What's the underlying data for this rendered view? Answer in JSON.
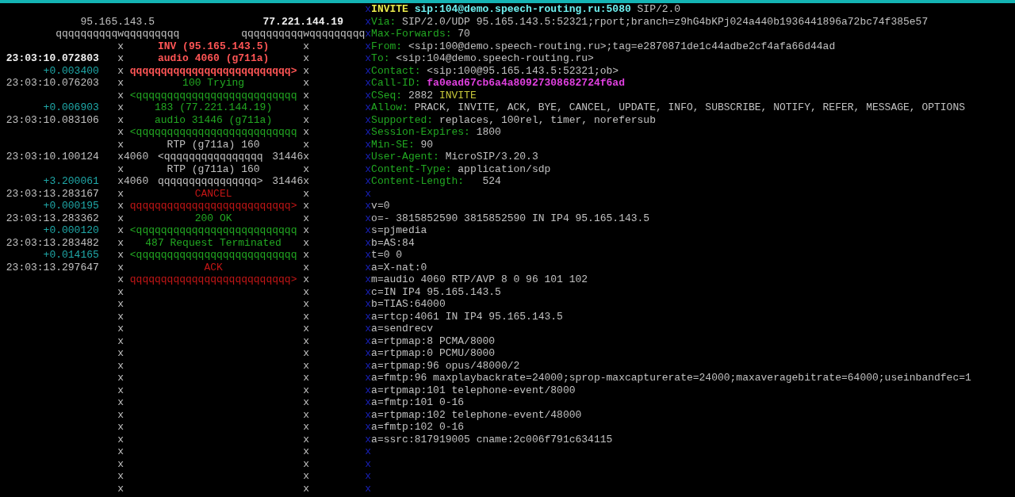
{
  "hosts": [
    {
      "address": "95.165.143.5",
      "rule": "qqqqqqqqqqwqqqqqqqqq",
      "selected": false
    },
    {
      "address": "77.221.144.19",
      "rule": "qqqqqqqqqqwqqqqqqqqq",
      "selected": true
    }
  ],
  "ladder": [
    {
      "left": "x",
      "label": "INV (95.165.143.5)",
      "right": "x",
      "kind": "invite"
    },
    {
      "time": {
        "text": "23:03:10.072803",
        "kind": "current"
      },
      "left": "x",
      "label": "audio 4060 (g711a)",
      "right": "x",
      "kind": "invite"
    },
    {
      "time": {
        "text": "+0.003400",
        "kind": "delta"
      },
      "left": "x",
      "arrow": "qqqqqqqqqqqqqqqqqqqqqqqqqq>",
      "right": "x",
      "kind": "invite"
    },
    {
      "time": {
        "text": "23:03:10.076203",
        "kind": "timestamp"
      },
      "left": "x",
      "label": "100 Trying",
      "right": "x",
      "kind": "response"
    },
    {
      "left": "x",
      "arrow": "<qqqqqqqqqqqqqqqqqqqqqqqqqq",
      "right": "x",
      "kind": "response"
    },
    {
      "time": {
        "text": "+0.006903",
        "kind": "delta"
      },
      "left": "x",
      "label": "183 (77.221.144.19)",
      "right": "x",
      "kind": "response"
    },
    {
      "time": {
        "text": "23:03:10.083106",
        "kind": "timestamp"
      },
      "left": "x",
      "label": "audio 31446 (g711a)",
      "right": "x",
      "kind": "response"
    },
    {
      "left": "x",
      "arrow": "<qqqqqqqqqqqqqqqqqqqqqqqqqq",
      "right": "x",
      "kind": "response"
    },
    {
      "left": "x",
      "label": "RTP (g711a) 160",
      "right": "x",
      "kind": "rtp"
    },
    {
      "time": {
        "text": "23:03:10.100124",
        "kind": "timestamp"
      },
      "left": "x4060",
      "arrow": "<qqqqqqqqqqqqqqqq",
      "right": "31446x",
      "kind": "rtp"
    },
    {
      "left": "x",
      "label": "RTP (g711a) 160",
      "right": "x",
      "kind": "rtp"
    },
    {
      "time": {
        "text": "+3.200061",
        "kind": "delta"
      },
      "left": "x4060",
      "arrow": "qqqqqqqqqqqqqqqq>",
      "right": "31446x",
      "kind": "rtp"
    },
    {
      "time": {
        "text": "23:03:13.283167",
        "kind": "timestamp"
      },
      "left": "x",
      "label": "CANCEL",
      "right": "x",
      "kind": "cancel"
    },
    {
      "time": {
        "text": "+0.000195",
        "kind": "delta"
      },
      "left": "x",
      "arrow": "qqqqqqqqqqqqqqqqqqqqqqqqqq>",
      "right": "x",
      "kind": "cancel"
    },
    {
      "time": {
        "text": "23:03:13.283362",
        "kind": "timestamp"
      },
      "left": "x",
      "label": "200 OK",
      "right": "x",
      "kind": "response"
    },
    {
      "time": {
        "text": "+0.000120",
        "kind": "delta"
      },
      "left": "x",
      "arrow": "<qqqqqqqqqqqqqqqqqqqqqqqqqq",
      "right": "x",
      "kind": "response"
    },
    {
      "time": {
        "text": "23:03:13.283482",
        "kind": "timestamp"
      },
      "left": "x",
      "label": "487 Request Terminated",
      "right": "x",
      "kind": "response"
    },
    {
      "time": {
        "text": "+0.014165",
        "kind": "delta"
      },
      "left": "x",
      "arrow": "<qqqqqqqqqqqqqqqqqqqqqqqqqq",
      "right": "x",
      "kind": "response"
    },
    {
      "time": {
        "text": "23:03:13.297647",
        "kind": "timestamp"
      },
      "left": "x",
      "label": "ACK",
      "right": "x",
      "kind": "cancel"
    },
    {
      "left": "x",
      "arrow": "qqqqqqqqqqqqqqqqqqqqqqqqqq>",
      "right": "x",
      "kind": "cancel"
    },
    {
      "left": "x",
      "right": "x"
    },
    {
      "left": "x",
      "right": "x"
    },
    {
      "left": "x",
      "right": "x"
    },
    {
      "left": "x",
      "right": "x"
    },
    {
      "left": "x",
      "right": "x"
    },
    {
      "left": "x",
      "right": "x"
    },
    {
      "left": "x",
      "right": "x"
    },
    {
      "left": "x",
      "right": "x"
    },
    {
      "left": "x",
      "right": "x"
    },
    {
      "left": "x",
      "right": "x"
    },
    {
      "left": "x",
      "right": "x"
    },
    {
      "left": "x",
      "right": "x"
    },
    {
      "left": "x",
      "right": "x"
    },
    {
      "left": "x",
      "right": "x"
    },
    {
      "left": "x",
      "right": "x"
    },
    {
      "left": "x",
      "right": "x"
    },
    {
      "left": "x",
      "right": "x"
    }
  ],
  "message": [
    {
      "border": "x",
      "kind": "request_line",
      "method": "INVITE",
      "uri": "sip:104@demo.speech-routing.ru:5080",
      "version": "SIP/2.0"
    },
    {
      "border": "x",
      "kind": "header",
      "name": "Via:",
      "value": "SIP/2.0/UDP 95.165.143.5:52321;rport;branch=z9hG4bKPj024a440b1936441896a72bc74f385e57"
    },
    {
      "border": "x",
      "kind": "header",
      "name": "Max-Forwards:",
      "value": "70"
    },
    {
      "border": "x",
      "kind": "header",
      "name": "From:",
      "value": "<sip:100@demo.speech-routing.ru>;tag=e2870871de1c44adbe2cf4afa66d44ad"
    },
    {
      "border": "x",
      "kind": "header",
      "name": "To:",
      "value": "<sip:104@demo.speech-routing.ru>"
    },
    {
      "border": "x",
      "kind": "header",
      "name": "Contact:",
      "value": "<sip:100@95.165.143.5:52321;ob>"
    },
    {
      "border": "x",
      "kind": "call_id",
      "name": "Call-ID:",
      "value": "fa0ead67cb6a4a80927308682724f6ad"
    },
    {
      "border": "x",
      "kind": "cseq",
      "name": "CSeq:",
      "number": "2882",
      "method": "INVITE"
    },
    {
      "border": "x",
      "kind": "header",
      "name": "Allow:",
      "value": "PRACK, INVITE, ACK, BYE, CANCEL, UPDATE, INFO, SUBSCRIBE, NOTIFY, REFER, MESSAGE, OPTIONS"
    },
    {
      "border": "x",
      "kind": "header",
      "name": "Supported:",
      "value": "replaces, 100rel, timer, norefersub"
    },
    {
      "border": "x",
      "kind": "header",
      "name": "Session-Expires:",
      "value": "1800"
    },
    {
      "border": "x",
      "kind": "header",
      "name": "Min-SE:",
      "value": "90"
    },
    {
      "border": "x",
      "kind": "header",
      "name": "User-Agent:",
      "value": "MicroSIP/3.20.3"
    },
    {
      "border": "x",
      "kind": "header",
      "name": "Content-Type:",
      "value": "application/sdp"
    },
    {
      "border": "x",
      "kind": "header",
      "name": "Content-Length:",
      "value": "  524"
    },
    {
      "border": "x",
      "kind": "blank"
    },
    {
      "border": "x",
      "kind": "body",
      "text": "v=0"
    },
    {
      "border": "x",
      "kind": "body",
      "text": "o=- 3815852590 3815852590 IN IP4 95.165.143.5"
    },
    {
      "border": "x",
      "kind": "body",
      "text": "s=pjmedia"
    },
    {
      "border": "x",
      "kind": "body",
      "text": "b=AS:84"
    },
    {
      "border": "x",
      "kind": "body",
      "text": "t=0 0"
    },
    {
      "border": "x",
      "kind": "body",
      "text": "a=X-nat:0"
    },
    {
      "border": "x",
      "kind": "body",
      "text": "m=audio 4060 RTP/AVP 8 0 96 101 102"
    },
    {
      "border": "x",
      "kind": "body",
      "text": "c=IN IP4 95.165.143.5"
    },
    {
      "border": "x",
      "kind": "body",
      "text": "b=TIAS:64000"
    },
    {
      "border": "x",
      "kind": "body",
      "text": "a=rtcp:4061 IN IP4 95.165.143.5"
    },
    {
      "border": "x",
      "kind": "body",
      "text": "a=sendrecv"
    },
    {
      "border": "x",
      "kind": "body",
      "text": "a=rtpmap:8 PCMA/8000"
    },
    {
      "border": "x",
      "kind": "body",
      "text": "a=rtpmap:0 PCMU/8000"
    },
    {
      "border": "x",
      "kind": "body",
      "text": "a=rtpmap:96 opus/48000/2"
    },
    {
      "border": "x",
      "kind": "body",
      "text": "a=fmtp:96 maxplaybackrate=24000;sprop-maxcapturerate=24000;maxaveragebitrate=64000;useinbandfec=1"
    },
    {
      "border": "x",
      "kind": "body",
      "text": "a=rtpmap:101 telephone-event/8000"
    },
    {
      "border": "x",
      "kind": "body",
      "text": "a=fmtp:101 0-16"
    },
    {
      "border": "x",
      "kind": "body",
      "text": "a=rtpmap:102 telephone-event/48000"
    },
    {
      "border": "x",
      "kind": "body",
      "text": "a=fmtp:102 0-16"
    },
    {
      "border": "x",
      "kind": "body",
      "text": "a=ssrc:817919005 cname:2c006f791c634115"
    },
    {
      "border": "x",
      "kind": "blank"
    },
    {
      "border": "x",
      "kind": "blank"
    },
    {
      "border": "x",
      "kind": "blank"
    },
    {
      "border": "x",
      "kind": "blank"
    }
  ]
}
